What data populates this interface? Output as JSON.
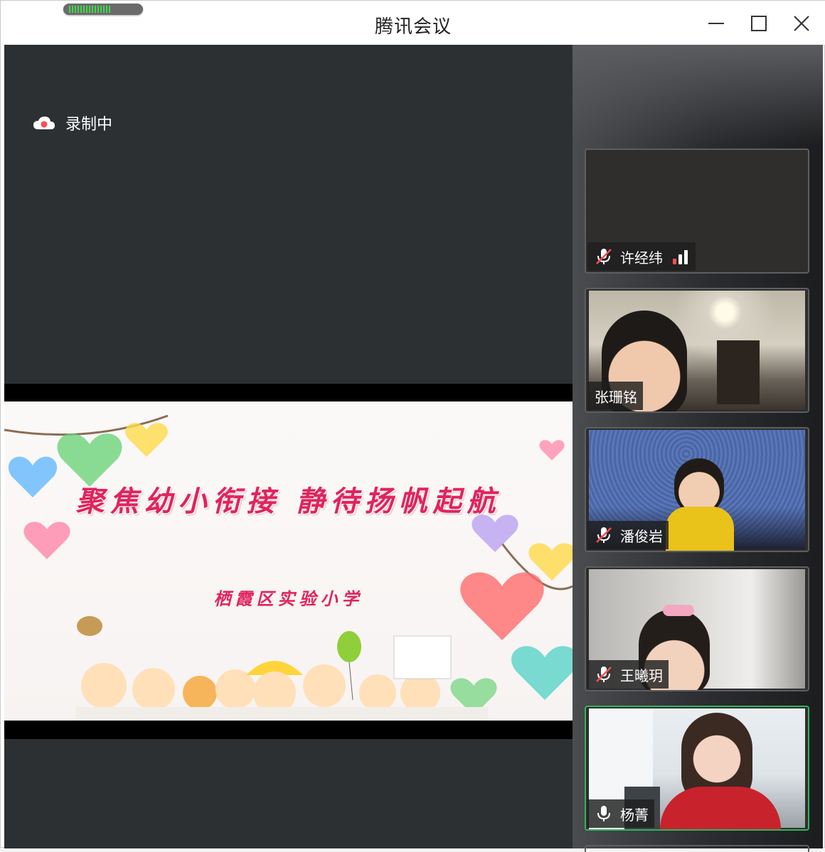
{
  "window": {
    "title": "腾讯会议",
    "controls": [
      "minimize",
      "maximize",
      "close"
    ]
  },
  "network_meter": {
    "icon": "network-quality-icon",
    "level": 0.6
  },
  "recording": {
    "label": "录制中",
    "icon": "cloud-record-icon",
    "accent": "#ff4d4f"
  },
  "shared_slide": {
    "title": "聚焦幼小衔接 静待扬帆起航",
    "subtitle": "栖霞区实验小学",
    "text_color": "#e0245e"
  },
  "participants": [
    {
      "name": "许经纬",
      "muted": true,
      "video": false,
      "signal_icon": "signal-strength-icon"
    },
    {
      "name": "张珊铭",
      "muted": false,
      "video": true,
      "mic_shown": false
    },
    {
      "name": "潘俊岩",
      "muted": true,
      "video": true
    },
    {
      "name": "王曦玥",
      "muted": true,
      "video": true
    },
    {
      "name": "杨菁",
      "muted": false,
      "video": true,
      "speaking": true
    }
  ],
  "colors": {
    "active_speaker_border": "#2fb55a",
    "stage_bg": "#2d3033"
  }
}
